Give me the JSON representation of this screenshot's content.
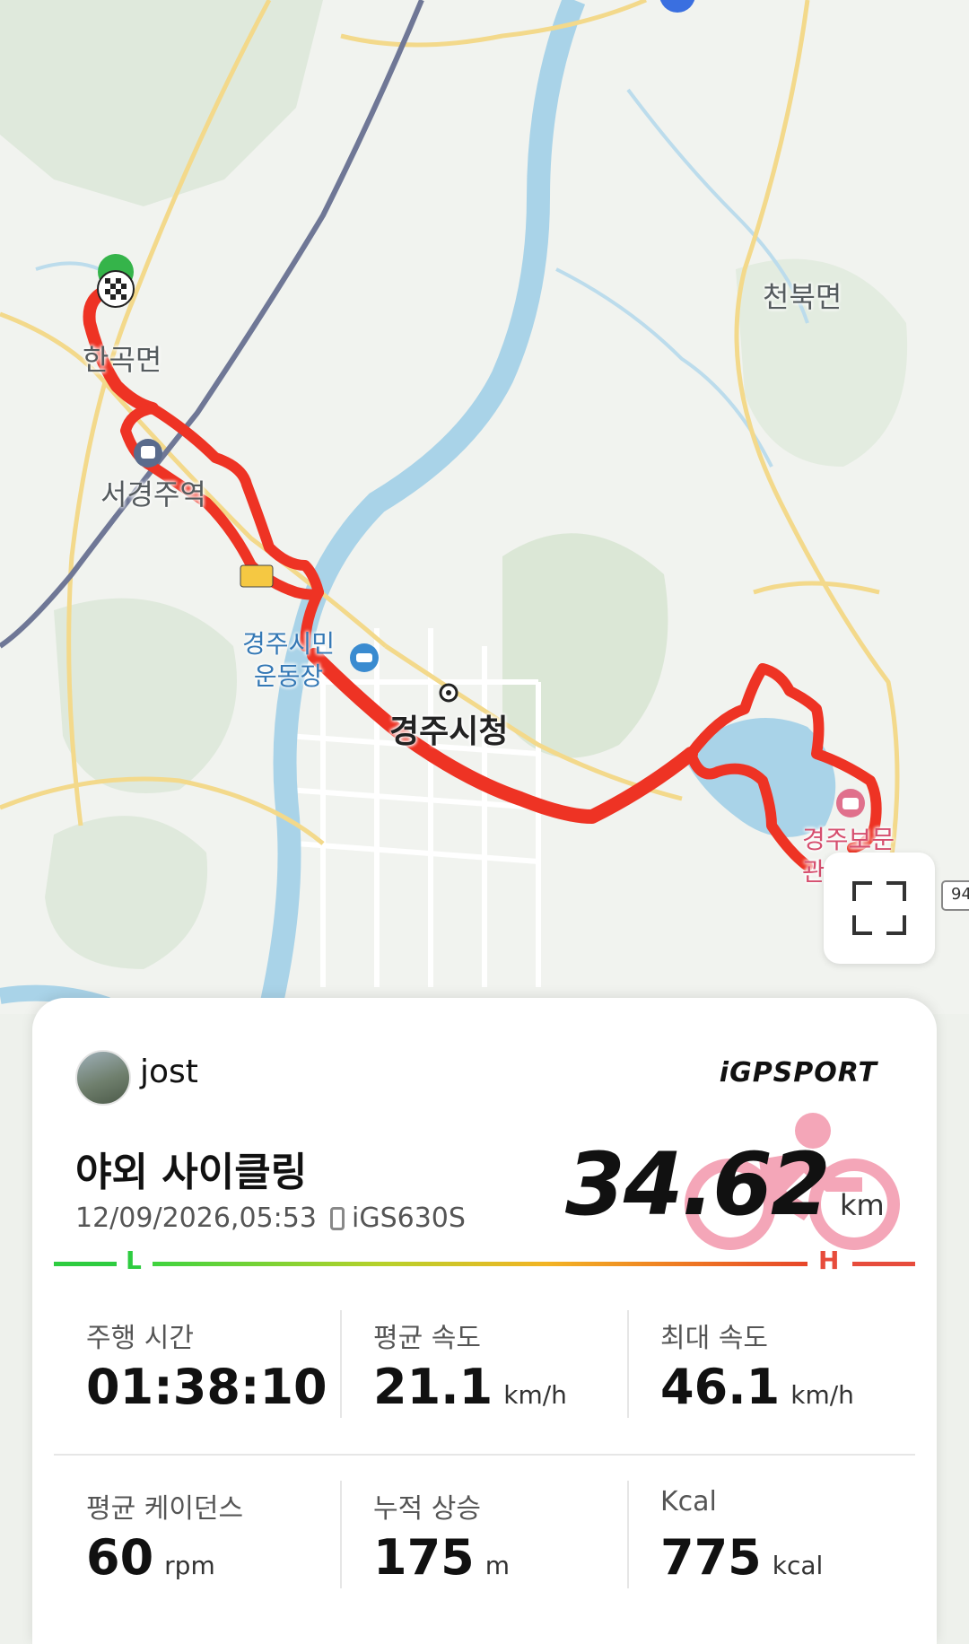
{
  "map": {
    "labels": {
      "hangok": "한곡면",
      "seogyeongju": "서경주역",
      "cheonbuk": "천북면",
      "stadium": "경주시민\n운동장",
      "cityhall": "경주시청",
      "bomun": "경주보문",
      "bomun2": "관",
      "road_number": "94"
    },
    "route_color": "#ee3324"
  },
  "activity": {
    "username": "jost",
    "brand": "iGPSPORT",
    "title": "야외 사이클링",
    "datetime": "12/09/2026,05:53",
    "device": "iGS630S",
    "distance": "34.62",
    "distance_unit": "km",
    "intensity_low": "L",
    "intensity_high": "H"
  },
  "stats": [
    {
      "label": "주행 시간",
      "value": "01:38:10",
      "unit": ""
    },
    {
      "label": "평균 속도",
      "value": "21.1",
      "unit": "km/h"
    },
    {
      "label": "최대 속도",
      "value": "46.1",
      "unit": "km/h"
    },
    {
      "label": "평균 케이던스",
      "value": "60",
      "unit": "rpm"
    },
    {
      "label": "누적 상승",
      "value": "175",
      "unit": "m"
    },
    {
      "label": "Kcal",
      "value": "775",
      "unit": "kcal"
    }
  ],
  "colors": {
    "intensity_low": "#2ecc40",
    "intensity_high": "#e74c3c",
    "brand_icon": "#f4a6b8"
  }
}
